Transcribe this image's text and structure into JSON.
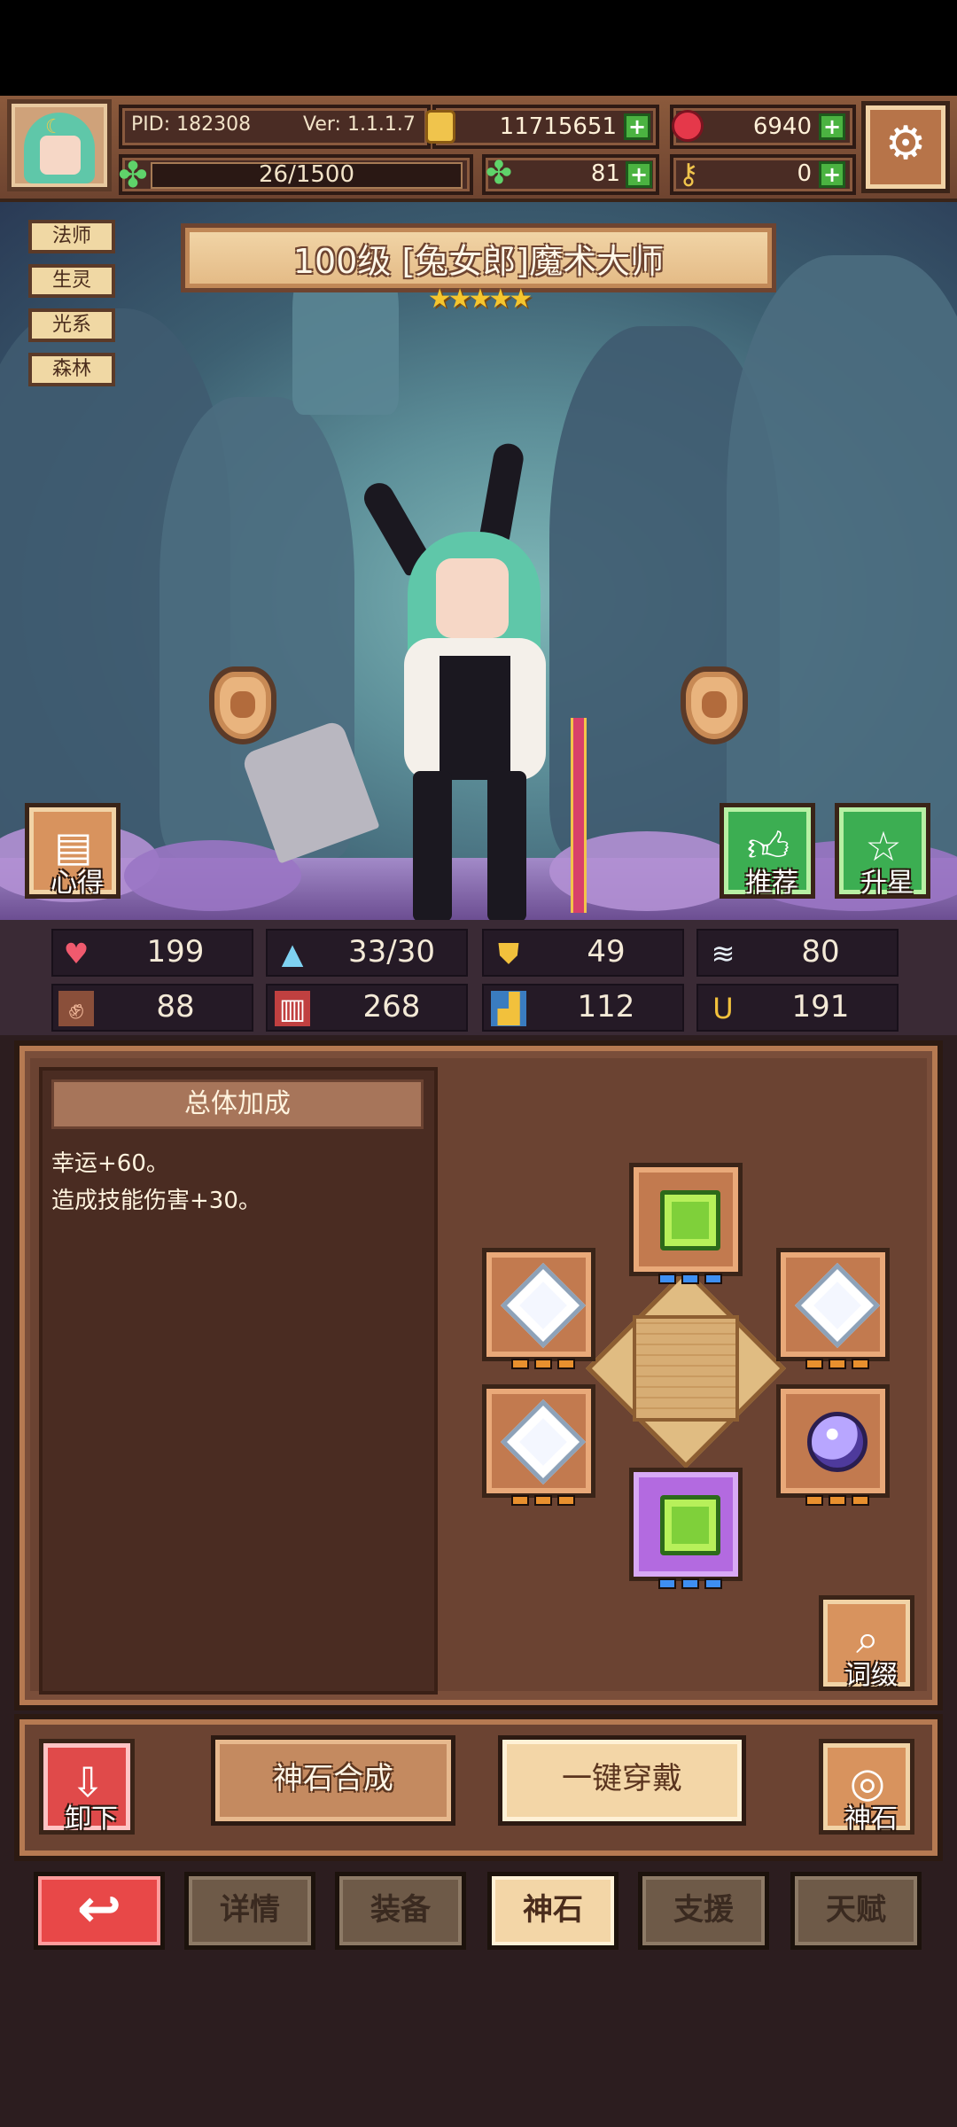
{
  "header": {
    "pid": "PID: 182308",
    "version": "Ver: 1.1.1.7",
    "exp": "26/1500",
    "gold": "11715651",
    "ruby": "6940",
    "clover": "81",
    "key": "0"
  },
  "tags": [
    "法师",
    "生灵",
    "光系",
    "森林"
  ],
  "character": {
    "title": "100级 [兔女郎]魔术大师",
    "stars": "★★★★★",
    "star_count": 5
  },
  "scene_buttons": {
    "xinde": "心得",
    "tuijian": "推荐",
    "shengxing": "升星"
  },
  "stats": [
    {
      "icon": "heart-icon",
      "value": "199"
    },
    {
      "icon": "mana-drop-icon",
      "value": "33/30"
    },
    {
      "icon": "shield-icon",
      "value": "49"
    },
    {
      "icon": "wing-icon",
      "value": "80"
    },
    {
      "icon": "fist-icon",
      "value": "88"
    },
    {
      "icon": "spellbook-icon",
      "value": "268"
    },
    {
      "icon": "boot-icon",
      "value": "112"
    },
    {
      "icon": "horseshoe-icon",
      "value": "191"
    }
  ],
  "bonus": {
    "title": "总体加成",
    "lines": [
      "幸运+60。",
      "造成技能伤害+30。"
    ]
  },
  "gem_slots": [
    {
      "position": "top",
      "gem": "green-gem",
      "frame": "orange",
      "level_color": "blue"
    },
    {
      "position": "left-upper",
      "gem": "white-diamond",
      "frame": "orange",
      "level_color": "orange"
    },
    {
      "position": "right-upper",
      "gem": "white-diamond",
      "frame": "orange",
      "level_color": "orange"
    },
    {
      "position": "left-lower",
      "gem": "white-diamond",
      "frame": "orange",
      "level_color": "orange"
    },
    {
      "position": "right-lower",
      "gem": "purple-orb",
      "frame": "orange",
      "level_color": "orange"
    },
    {
      "position": "bottom",
      "gem": "green-gem",
      "frame": "purple",
      "level_color": "blue"
    }
  ],
  "side_buttons": {
    "cizhui": "词缀",
    "xiexia": "卸下",
    "shenshi": "神石"
  },
  "actions": {
    "hecheng": "神石合成",
    "chuandai": "一键穿戴"
  },
  "tabs": {
    "back_icon": "↩",
    "items": [
      "详情",
      "装备",
      "神石",
      "支援",
      "天赋"
    ],
    "active_index": 2
  },
  "colors": {
    "accent_gold": "#f5c62e",
    "plus_green": "#4bb341",
    "back_red": "#e84848",
    "active_tab": "#f3d6a7"
  }
}
